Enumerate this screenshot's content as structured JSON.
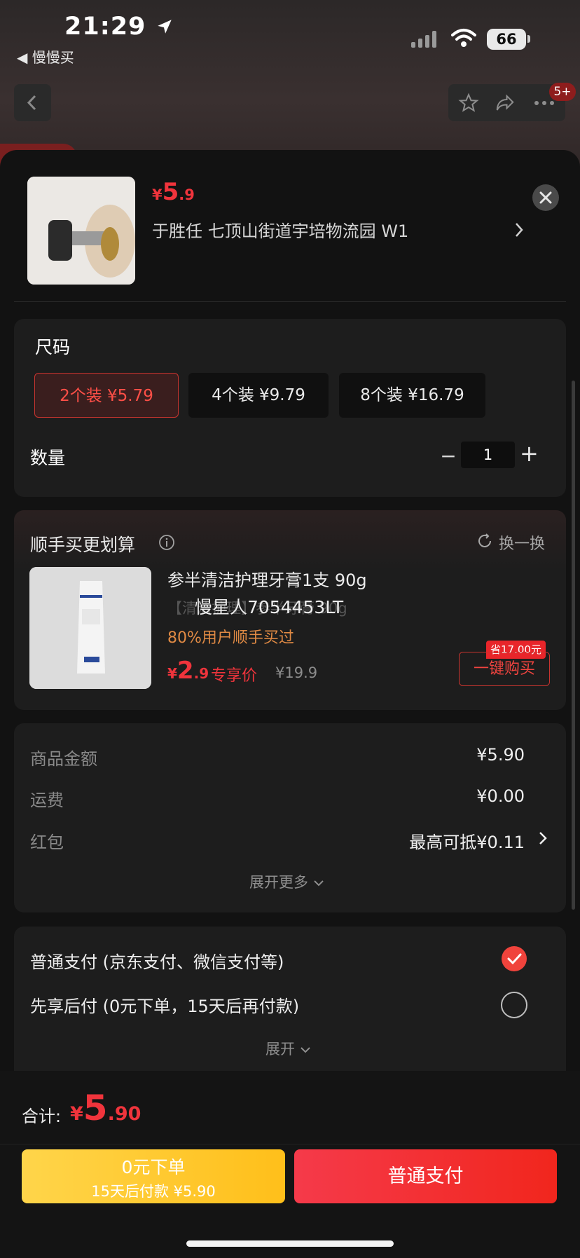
{
  "status_bar": {
    "time": "21:29",
    "back_app": "◀ 慢慢买",
    "battery": "66"
  },
  "nav": {
    "badge": "5+"
  },
  "product": {
    "price_yen": "¥",
    "price_int": "5",
    "price_dec": ".9",
    "address": "于胜任  七顶山街道宇培物流园 W1"
  },
  "size": {
    "title": "尺码",
    "options": [
      {
        "label": "2个装  ¥5.79",
        "selected": true
      },
      {
        "label": "4个装  ¥9.79",
        "selected": false
      },
      {
        "label": "8个装  ¥16.79",
        "selected": false
      }
    ]
  },
  "quantity": {
    "label": "数量",
    "minus": "−",
    "value": "1",
    "plus": "+"
  },
  "upsell": {
    "title": "顺手买更划算",
    "swap_label": "换一换",
    "product_name": "参半清洁护理牙膏1支 90g",
    "ghost_text": "【清洁护理】参半牙膏 90g",
    "watermark": "慢星人7054453LT",
    "social_proof": "80%用户顺手买过",
    "price_yen": "¥",
    "price_int": "2",
    "price_dec": ".9",
    "price_tag": "专享价",
    "original_price": "¥19.9",
    "save_tag": "省17.00元",
    "buy_button": "一键购买"
  },
  "summary": {
    "rows": [
      {
        "label": "商品金额",
        "value": "¥5.90"
      },
      {
        "label": "运费",
        "value": "¥0.00"
      },
      {
        "label": "红包",
        "value": "最高可抵¥0.11"
      }
    ],
    "expand_more": "展开更多"
  },
  "payment": {
    "options": [
      {
        "label": "普通支付 (京东支付、微信支付等)",
        "checked": true
      },
      {
        "label": "先享后付 (0元下单，15天后再付款)",
        "checked": false
      }
    ],
    "expand": "展开"
  },
  "footer": {
    "total_label": "合计:",
    "total_yen": "¥",
    "total_int": "5",
    "total_dec": ".90",
    "later_line1": "0元下单",
    "later_line2": "15天后付款 ¥5.90",
    "pay_button": "普通支付"
  },
  "colors": {
    "accent_red": "#f0343c",
    "later_yellow": "#ffc724",
    "card_bg": "#1d1d1d"
  },
  "icons": [
    "location-arrow-icon",
    "signal-icon",
    "wifi-icon",
    "battery-icon",
    "back-chevron-icon",
    "star-icon",
    "share-icon",
    "more-icon",
    "close-icon",
    "chevron-right-icon",
    "info-icon",
    "refresh-icon",
    "chevron-down-icon",
    "check-icon"
  ]
}
